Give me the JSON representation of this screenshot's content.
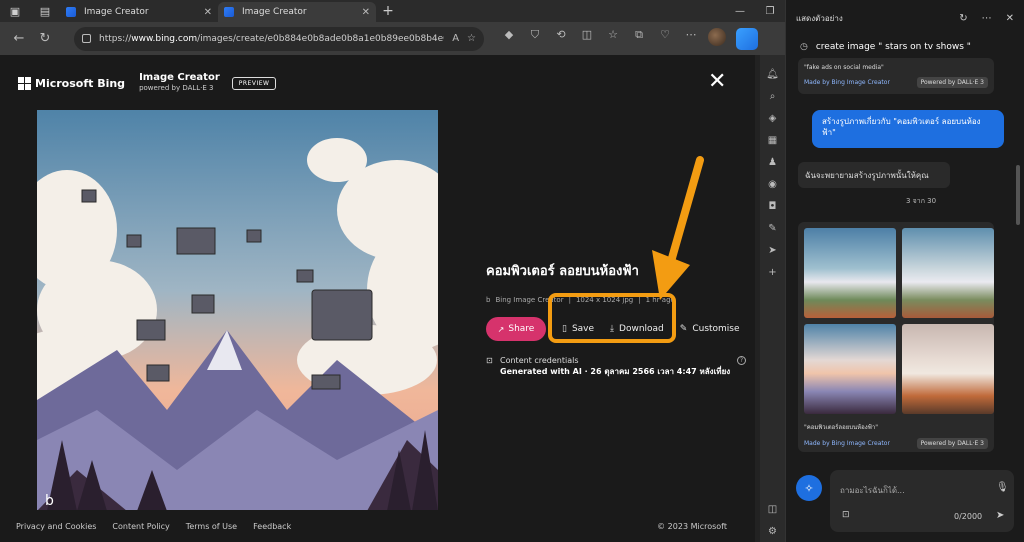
{
  "browser": {
    "tabs": [
      {
        "title": "Image Creator",
        "active": false
      },
      {
        "title": "Image Creator",
        "active": true
      }
    ],
    "url_prefix": "https://",
    "url_domain": "www.bing.com",
    "url_path": "/images/create/e0b884e0b8ade0b8a1e0b89ee0b8b4e0..."
  },
  "header": {
    "brand": "Microsoft Bing",
    "product": "Image Creator",
    "powered_by": "powered by DALL·E 3",
    "badge": "PREVIEW"
  },
  "image_info": {
    "title": "คอมพิวเตอร์ ลอยบนห้องฟ้า",
    "source": "Bing Image Creator",
    "dimensions": "1024 x 1024 jpg",
    "time_ago": "1 hr ago",
    "actions": {
      "share": "Share",
      "save": "Save",
      "download": "Download",
      "customise": "Customise"
    },
    "credentials_title": "Content credentials",
    "credentials_detail": "Generated with AI · 26 ตุลาคม 2566 เวลา 4:47 หลังเที่ยง"
  },
  "footer": {
    "links": [
      "Privacy and Cookies",
      "Content Policy",
      "Terms of Use",
      "Feedback"
    ],
    "copyright": "© 2023 Microsoft"
  },
  "copilot": {
    "header_label": "แสดงตัวอย่าง",
    "topic": "create image \" stars on tv shows \"",
    "prev_card_quote": "\"fake ads on social media\"",
    "made_by": "Made by Bing Image Creator",
    "powered_by": "Powered by DALL·E 3",
    "user_message": "สร้างรูปภาพเกี่ยวกับ \"คอมพิวเตอร์ ลอยบนห้องฟ้า\"",
    "bot_message": "ฉันจะพยายามสร้างรูปภาพนั้นให้คุณ",
    "page_counter": "3 จาก 30",
    "grid_quote": "\"คอมพิวเตอร์ลอยบนห้องฟ้า\"",
    "input_placeholder": "ถามอะไรฉันก็ได้...",
    "char_count": "0/2000"
  },
  "colors": {
    "accent_blue": "#1e6fe0",
    "share_pink": "#d6336c",
    "highlight_orange": "#f39c12"
  }
}
